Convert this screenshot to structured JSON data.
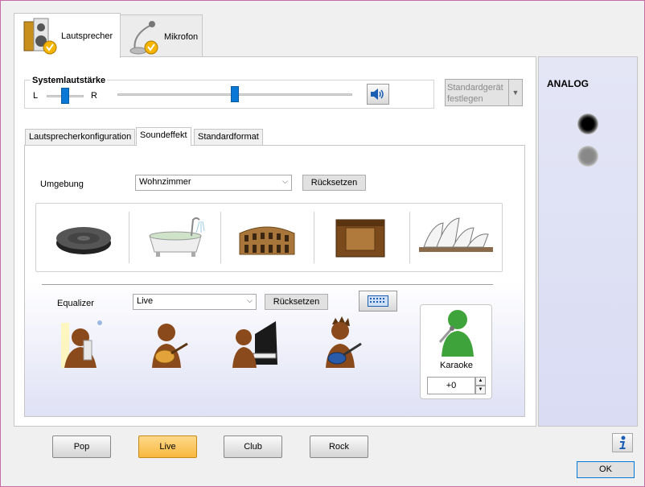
{
  "device_tabs": [
    {
      "label": "Lautsprecher",
      "icon": "speaker-icon"
    },
    {
      "label": "Mikrofon",
      "icon": "microphone-icon"
    }
  ],
  "system_volume": {
    "title": "Systemlautstärke",
    "left_label": "L",
    "right_label": "R",
    "balance": 0.5,
    "volume": 0.5
  },
  "default_device_button": {
    "line1": "Standardgerät",
    "line2": "festlegen"
  },
  "inner_tabs": [
    "Lautsprecherkonfiguration",
    "Soundeffekt",
    "Standardformat"
  ],
  "environment": {
    "label": "Umgebung",
    "selected": "Wohnzimmer",
    "reset_label": "Rücksetzen",
    "images": [
      "stone-disc-icon",
      "bathtub-icon",
      "colosseum-icon",
      "stone-room-icon",
      "opera-house-icon"
    ]
  },
  "equalizer": {
    "label": "Equalizer",
    "selected": "Live",
    "reset_label": "Rücksetzen",
    "presets": [
      {
        "label": "Pop",
        "active": false
      },
      {
        "label": "Live",
        "active": true
      },
      {
        "label": "Club",
        "active": false
      },
      {
        "label": "Rock",
        "active": false
      }
    ]
  },
  "karaoke": {
    "label": "Karaoke",
    "value": "+0"
  },
  "analog": {
    "title": "ANALOG"
  },
  "ok_label": "OK",
  "colors": {
    "accent": "#0a78d7",
    "active_preset": "#f8b83e",
    "right_panel": "#dcdff4"
  }
}
